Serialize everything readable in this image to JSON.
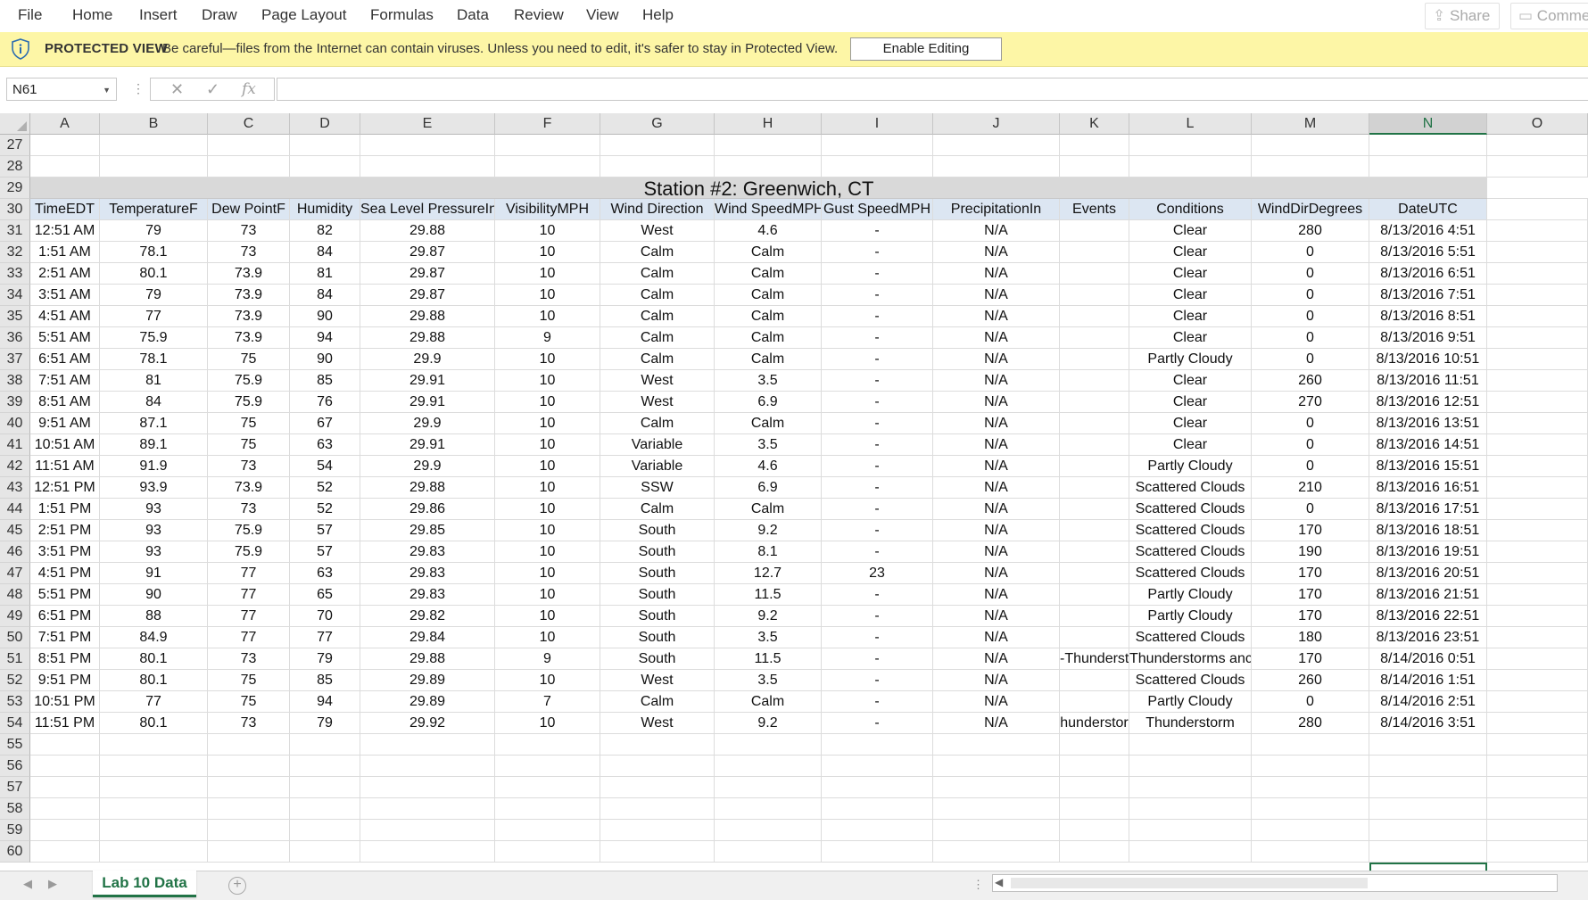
{
  "menu": [
    "File",
    "Home",
    "Insert",
    "Draw",
    "Page Layout",
    "Formulas",
    "Data",
    "Review",
    "View",
    "Help"
  ],
  "top_buttons": {
    "share": "Share",
    "comments": "Comme"
  },
  "protected_view": {
    "title": "PROTECTED VIEW",
    "message": "Be careful—files from the Internet can contain viruses. Unless you need to edit, it's safer to stay in Protected View.",
    "button": "Enable Editing"
  },
  "formula_bar": {
    "name_box": "N61",
    "fx": "fx",
    "cancel": "✕",
    "enter": "✓",
    "formula": ""
  },
  "columns": [
    "A",
    "B",
    "C",
    "D",
    "E",
    "F",
    "G",
    "H",
    "I",
    "J",
    "K",
    "L",
    "M",
    "N",
    "O"
  ],
  "selected_column": "N",
  "sheet_title": "Station #2: Greenwich, CT",
  "header": [
    "TimeEDT",
    "TemperatureF",
    "Dew PointF",
    "Humidity",
    "Sea Level PressureIn",
    "VisibilityMPH",
    "Wind Direction",
    "Wind SpeedMPH",
    "Gust SpeedMPH",
    "PrecipitationIn",
    "Events",
    "Conditions",
    "WindDirDegrees",
    "DateUTC"
  ],
  "rows": [
    [
      "12:51 AM",
      "79",
      "73",
      "82",
      "29.88",
      "10",
      "West",
      "4.6",
      "-",
      "N/A",
      "",
      "Clear",
      "280",
      "8/13/2016 4:51"
    ],
    [
      "1:51 AM",
      "78.1",
      "73",
      "84",
      "29.87",
      "10",
      "Calm",
      "Calm",
      "-",
      "N/A",
      "",
      "Clear",
      "0",
      "8/13/2016 5:51"
    ],
    [
      "2:51 AM",
      "80.1",
      "73.9",
      "81",
      "29.87",
      "10",
      "Calm",
      "Calm",
      "-",
      "N/A",
      "",
      "Clear",
      "0",
      "8/13/2016 6:51"
    ],
    [
      "3:51 AM",
      "79",
      "73.9",
      "84",
      "29.87",
      "10",
      "Calm",
      "Calm",
      "-",
      "N/A",
      "",
      "Clear",
      "0",
      "8/13/2016 7:51"
    ],
    [
      "4:51 AM",
      "77",
      "73.9",
      "90",
      "29.88",
      "10",
      "Calm",
      "Calm",
      "-",
      "N/A",
      "",
      "Clear",
      "0",
      "8/13/2016 8:51"
    ],
    [
      "5:51 AM",
      "75.9",
      "73.9",
      "94",
      "29.88",
      "9",
      "Calm",
      "Calm",
      "-",
      "N/A",
      "",
      "Clear",
      "0",
      "8/13/2016 9:51"
    ],
    [
      "6:51 AM",
      "78.1",
      "75",
      "90",
      "29.9",
      "10",
      "Calm",
      "Calm",
      "-",
      "N/A",
      "",
      "Partly Cloudy",
      "0",
      "8/13/2016 10:51"
    ],
    [
      "7:51 AM",
      "81",
      "75.9",
      "85",
      "29.91",
      "10",
      "West",
      "3.5",
      "-",
      "N/A",
      "",
      "Clear",
      "260",
      "8/13/2016 11:51"
    ],
    [
      "8:51 AM",
      "84",
      "75.9",
      "76",
      "29.91",
      "10",
      "West",
      "6.9",
      "-",
      "N/A",
      "",
      "Clear",
      "270",
      "8/13/2016 12:51"
    ],
    [
      "9:51 AM",
      "87.1",
      "75",
      "67",
      "29.9",
      "10",
      "Calm",
      "Calm",
      "-",
      "N/A",
      "",
      "Clear",
      "0",
      "8/13/2016 13:51"
    ],
    [
      "10:51 AM",
      "89.1",
      "75",
      "63",
      "29.91",
      "10",
      "Variable",
      "3.5",
      "-",
      "N/A",
      "",
      "Clear",
      "0",
      "8/13/2016 14:51"
    ],
    [
      "11:51 AM",
      "91.9",
      "73",
      "54",
      "29.9",
      "10",
      "Variable",
      "4.6",
      "-",
      "N/A",
      "",
      "Partly Cloudy",
      "0",
      "8/13/2016 15:51"
    ],
    [
      "12:51 PM",
      "93.9",
      "73.9",
      "52",
      "29.88",
      "10",
      "SSW",
      "6.9",
      "-",
      "N/A",
      "",
      "Scattered Clouds",
      "210",
      "8/13/2016 16:51"
    ],
    [
      "1:51 PM",
      "93",
      "73",
      "52",
      "29.86",
      "10",
      "Calm",
      "Calm",
      "-",
      "N/A",
      "",
      "Scattered Clouds",
      "0",
      "8/13/2016 17:51"
    ],
    [
      "2:51 PM",
      "93",
      "75.9",
      "57",
      "29.85",
      "10",
      "South",
      "9.2",
      "-",
      "N/A",
      "",
      "Scattered Clouds",
      "170",
      "8/13/2016 18:51"
    ],
    [
      "3:51 PM",
      "93",
      "75.9",
      "57",
      "29.83",
      "10",
      "South",
      "8.1",
      "-",
      "N/A",
      "",
      "Scattered Clouds",
      "190",
      "8/13/2016 19:51"
    ],
    [
      "4:51 PM",
      "91",
      "77",
      "63",
      "29.83",
      "10",
      "South",
      "12.7",
      "23",
      "N/A",
      "",
      "Scattered Clouds",
      "170",
      "8/13/2016 20:51"
    ],
    [
      "5:51 PM",
      "90",
      "77",
      "65",
      "29.83",
      "10",
      "South",
      "11.5",
      "-",
      "N/A",
      "",
      "Partly Cloudy",
      "170",
      "8/13/2016 21:51"
    ],
    [
      "6:51 PM",
      "88",
      "77",
      "70",
      "29.82",
      "10",
      "South",
      "9.2",
      "-",
      "N/A",
      "",
      "Partly Cloudy",
      "170",
      "8/13/2016 22:51"
    ],
    [
      "7:51 PM",
      "84.9",
      "77",
      "77",
      "29.84",
      "10",
      "South",
      "3.5",
      "-",
      "N/A",
      "",
      "Scattered Clouds",
      "180",
      "8/13/2016 23:51"
    ],
    [
      "8:51 PM",
      "80.1",
      "73",
      "79",
      "29.88",
      "9",
      "South",
      "11.5",
      "-",
      "N/A",
      "-Thunderst",
      "Thunderstorms anc",
      "170",
      "8/14/2016 0:51"
    ],
    [
      "9:51 PM",
      "80.1",
      "75",
      "85",
      "29.89",
      "10",
      "West",
      "3.5",
      "-",
      "N/A",
      "",
      "Scattered Clouds",
      "260",
      "8/14/2016 1:51"
    ],
    [
      "10:51 PM",
      "77",
      "75",
      "94",
      "29.89",
      "7",
      "Calm",
      "Calm",
      "-",
      "N/A",
      "",
      "Partly Cloudy",
      "0",
      "8/14/2016 2:51"
    ],
    [
      "11:51 PM",
      "80.1",
      "73",
      "79",
      "29.92",
      "10",
      "West",
      "9.2",
      "-",
      "N/A",
      "hunderstor",
      "Thunderstorm",
      "280",
      "8/14/2016 3:51"
    ]
  ],
  "row_numbers": [
    27,
    28,
    29,
    30,
    31,
    32,
    33,
    34,
    35,
    36,
    37,
    38,
    39,
    40,
    41,
    42,
    43,
    44,
    45,
    46,
    47,
    48,
    49,
    50,
    51,
    52,
    53,
    54,
    55,
    56,
    57,
    58,
    59,
    60
  ],
  "sheet_tab": "Lab 10 Data",
  "add_sheet": "+",
  "colors": {
    "accent": "#217346",
    "protected_bg": "#fdf6a6",
    "header_fill": "#dce6f2",
    "title_fill": "#d9d9d9"
  }
}
